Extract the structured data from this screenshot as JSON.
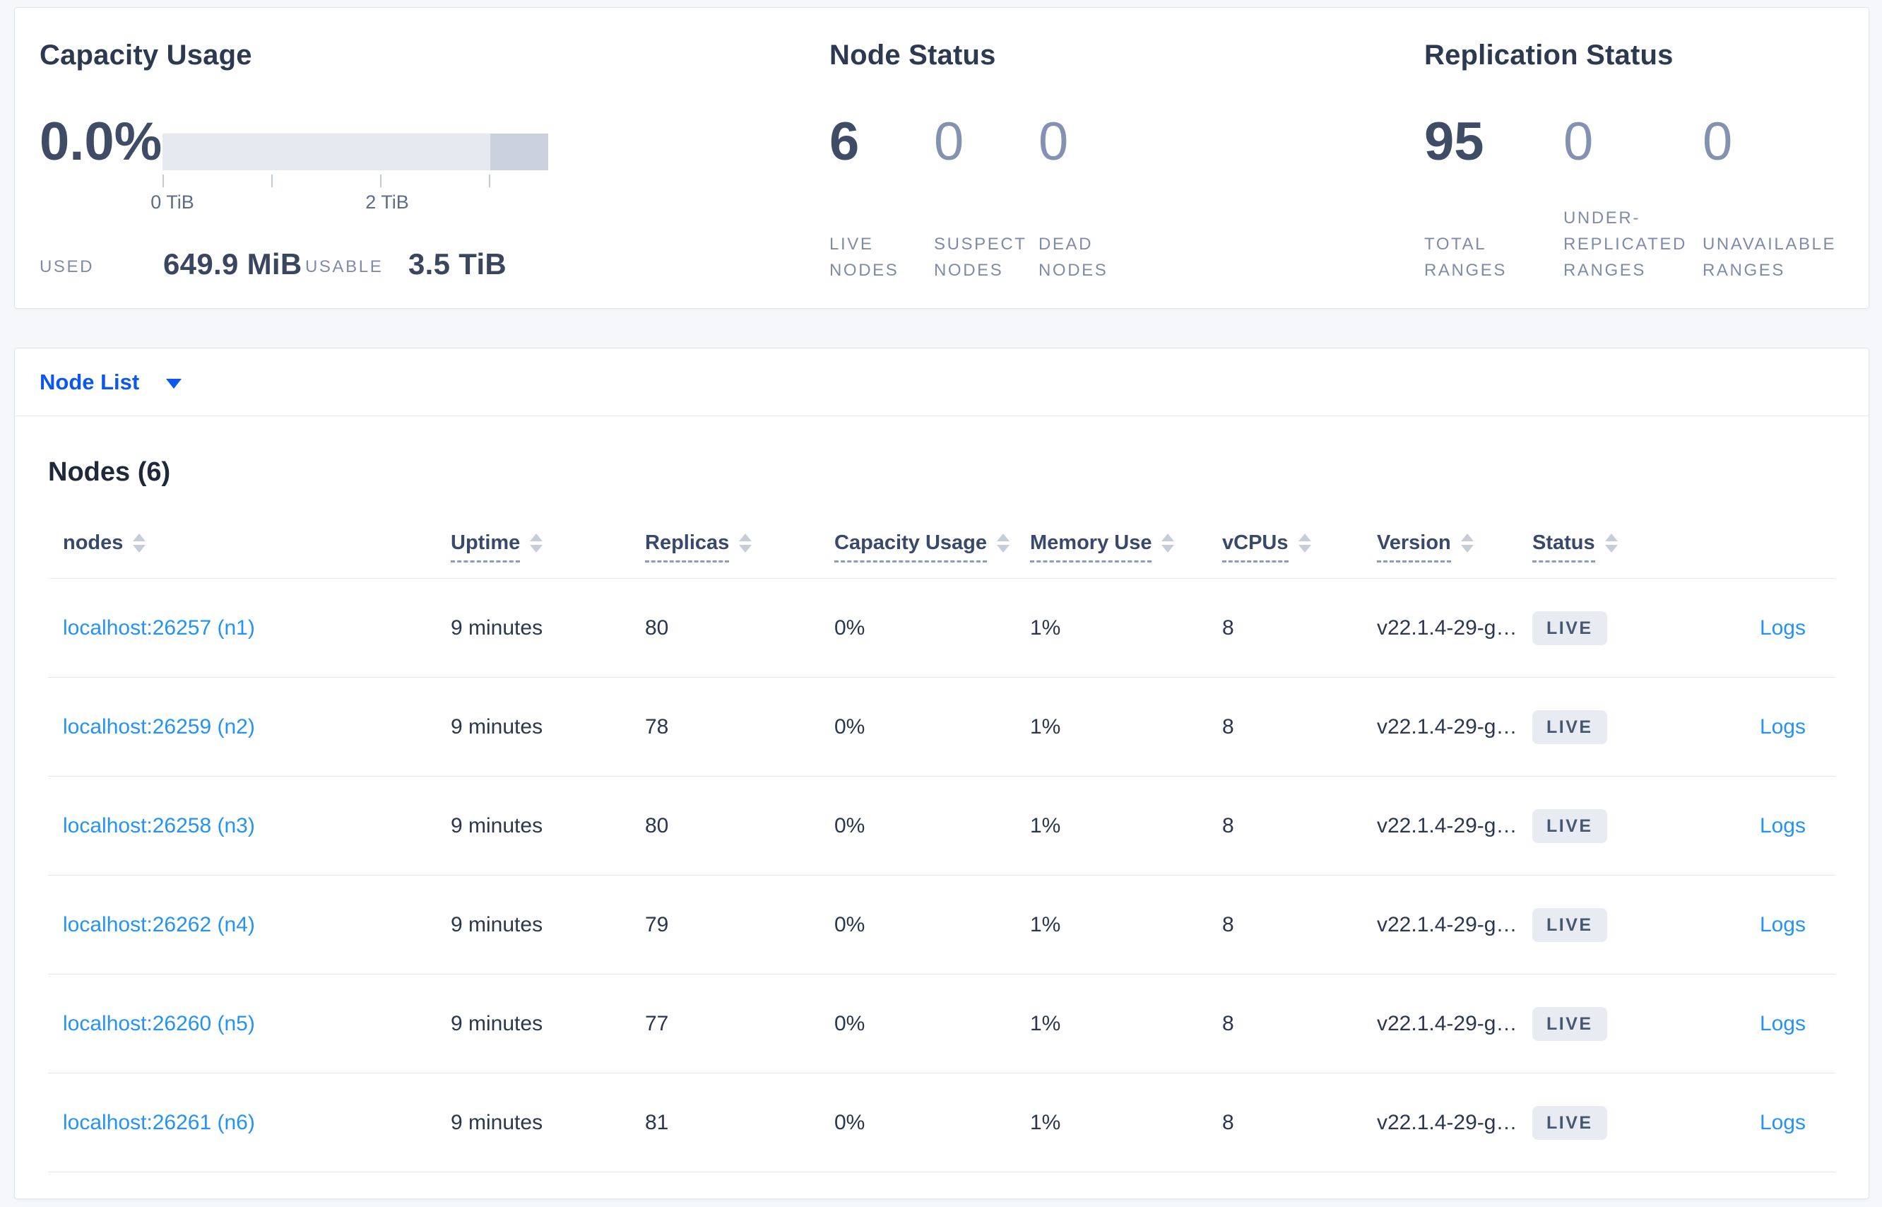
{
  "summary": {
    "capacity": {
      "title": "Capacity Usage",
      "percent": "0.0%",
      "used_label": "USED",
      "used_value": "649.9 MiB",
      "usable_label": "USABLE",
      "usable_value": "3.5 TiB",
      "axis_tick_labels": [
        "0 TiB",
        "2 TiB"
      ],
      "bar": {
        "track_color": "#e6e9ef",
        "segment_color": "#ccd2dd",
        "used_fraction": 0.0
      }
    },
    "node_status": {
      "title": "Node Status",
      "stats": [
        {
          "value": "6",
          "label": "LIVE NODES"
        },
        {
          "value": "0",
          "label": "SUSPECT NODES"
        },
        {
          "value": "0",
          "label": "DEAD NODES"
        }
      ]
    },
    "replication_status": {
      "title": "Replication Status",
      "stats": [
        {
          "value": "95",
          "label": "TOTAL RANGES"
        },
        {
          "value": "0",
          "label": "UNDER-REPLICATED RANGES"
        },
        {
          "value": "0",
          "label": "UNAVAILABLE RANGES"
        }
      ]
    }
  },
  "view_selector": {
    "label": "Node List"
  },
  "table": {
    "heading": "Nodes (6)",
    "columns": [
      {
        "label": "nodes"
      },
      {
        "label": "Uptime"
      },
      {
        "label": "Replicas"
      },
      {
        "label": "Capacity Usage"
      },
      {
        "label": "Memory Use"
      },
      {
        "label": "vCPUs"
      },
      {
        "label": "Version"
      },
      {
        "label": "Status"
      }
    ],
    "rows": [
      {
        "node": "localhost:26257 (n1)",
        "uptime": "9 minutes",
        "replicas": "80",
        "capacity": "0%",
        "memory": "1%",
        "vcpus": "8",
        "version": "v22.1.4-29-g…",
        "status": "LIVE",
        "logs": "Logs"
      },
      {
        "node": "localhost:26259 (n2)",
        "uptime": "9 minutes",
        "replicas": "78",
        "capacity": "0%",
        "memory": "1%",
        "vcpus": "8",
        "version": "v22.1.4-29-g…",
        "status": "LIVE",
        "logs": "Logs"
      },
      {
        "node": "localhost:26258 (n3)",
        "uptime": "9 minutes",
        "replicas": "80",
        "capacity": "0%",
        "memory": "1%",
        "vcpus": "8",
        "version": "v22.1.4-29-g…",
        "status": "LIVE",
        "logs": "Logs"
      },
      {
        "node": "localhost:26262 (n4)",
        "uptime": "9 minutes",
        "replicas": "79",
        "capacity": "0%",
        "memory": "1%",
        "vcpus": "8",
        "version": "v22.1.4-29-g…",
        "status": "LIVE",
        "logs": "Logs"
      },
      {
        "node": "localhost:26260 (n5)",
        "uptime": "9 minutes",
        "replicas": "77",
        "capacity": "0%",
        "memory": "1%",
        "vcpus": "8",
        "version": "v22.1.4-29-g…",
        "status": "LIVE",
        "logs": "Logs"
      },
      {
        "node": "localhost:26261 (n6)",
        "uptime": "9 minutes",
        "replicas": "81",
        "capacity": "0%",
        "memory": "1%",
        "vcpus": "8",
        "version": "v22.1.4-29-g…",
        "status": "LIVE",
        "logs": "Logs"
      }
    ]
  },
  "colors": {
    "primary_blue": "#0b57f0",
    "link_blue": "#2493f3",
    "emphasis_text": "#3f4c66",
    "muted_stat": "#8492b2",
    "label_gray": "#7f8ba9",
    "badge_bg": "#e8ecf2",
    "badge_text": "#475872",
    "page_bg": "#f5f7fa"
  }
}
